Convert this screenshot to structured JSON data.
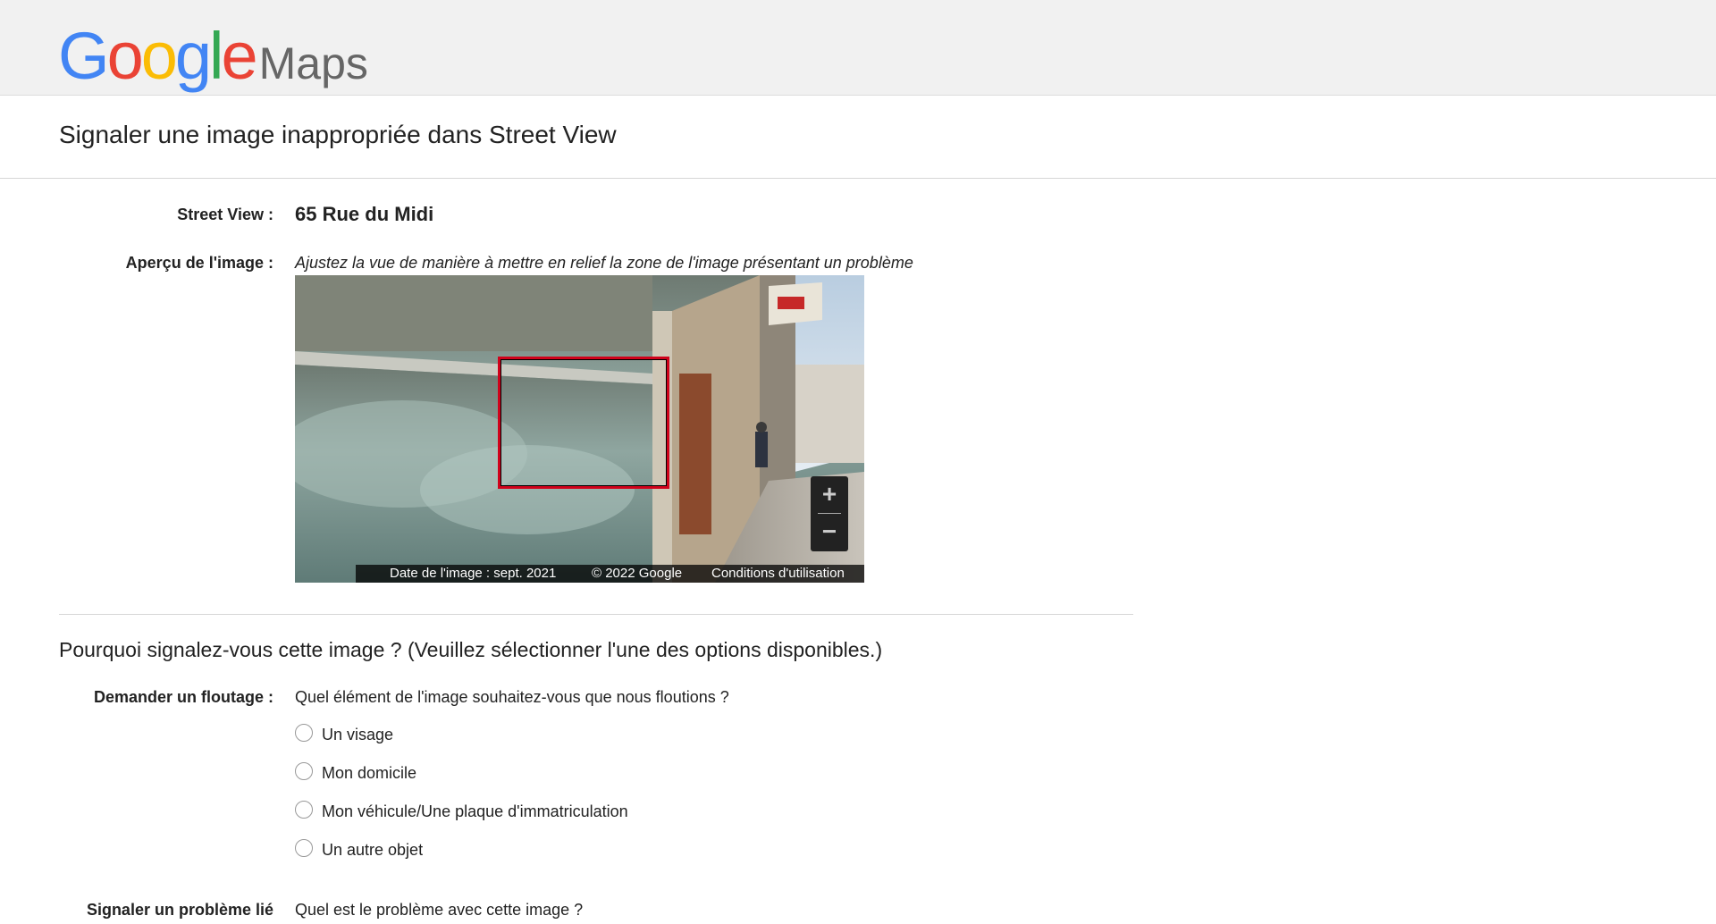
{
  "header": {
    "logo_google": "Google",
    "logo_maps": "Maps",
    "logo_colors": [
      "#4285F4",
      "#EA4335",
      "#FBBC05",
      "#4285F4",
      "#34A853",
      "#EA4335"
    ]
  },
  "page_title": "Signaler une image inappropriée dans Street View",
  "street_view": {
    "label": "Street View :",
    "value": "65 Rue du Midi"
  },
  "preview": {
    "label": "Aperçu de l'image :",
    "hint": "Ajustez la vue de manière à mettre en relief la zone de l'image présentant un problème",
    "zoom_in": "+",
    "zoom_out": "−",
    "image_date": "Date de l'image : sept. 2021",
    "copyright": "© 2022 Google",
    "terms": "Conditions d'utilisation",
    "highlight_color": "#d0021b"
  },
  "reason": {
    "heading": "Pourquoi signalez-vous cette image ?  (Veuillez sélectionner l'une des options disponibles.)"
  },
  "blur_request": {
    "label": "Demander un floutage :",
    "question": "Quel élément de l'image souhaitez-vous que nous floutions ?",
    "options": [
      "Un visage",
      "Mon domicile",
      "Mon véhicule/Une plaque d'immatriculation",
      "Un autre objet"
    ]
  },
  "related_issue": {
    "label": "Signaler un problème lié",
    "question": "Quel est le problème avec cette image ?"
  }
}
